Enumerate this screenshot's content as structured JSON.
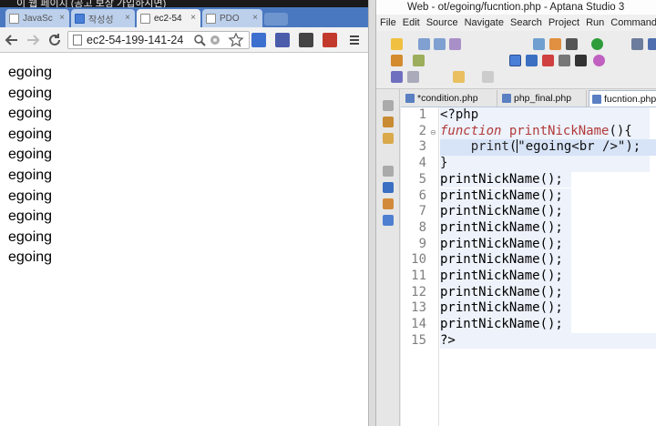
{
  "video_title": "이 웹 페이지 (공고 보상 가입하시면)",
  "browser": {
    "tabs": [
      {
        "label": "JavaSc",
        "active": false
      },
      {
        "label": "작성성",
        "active": false
      },
      {
        "label": "ec2-54",
        "active": true
      },
      {
        "label": "PDO",
        "active": false
      }
    ],
    "close_glyph": "×",
    "address": "ec2-54-199-141-24",
    "output_lines": [
      "egoing",
      "egoing",
      "egoing",
      "egoing",
      "egoing",
      "egoing",
      "egoing",
      "egoing",
      "egoing",
      "egoing"
    ]
  },
  "ide": {
    "window_title": "Web - ot/egoing/fucntion.php - Aptana Studio 3",
    "menu": [
      "File",
      "Edit",
      "Source",
      "Navigate",
      "Search",
      "Project",
      "Run",
      "Commands"
    ],
    "editor_tabs": [
      {
        "label": "*condition.php",
        "active": false
      },
      {
        "label": "php_final.php",
        "active": false
      },
      {
        "label": "fucntion.php",
        "active": true
      }
    ],
    "line_numbers": [
      "1",
      "2",
      "3",
      "4",
      "5",
      "6",
      "7",
      "8",
      "9",
      "10",
      "11",
      "12",
      "13",
      "14",
      "15"
    ],
    "code": {
      "l1": "<?php",
      "l2_kw": "function",
      "l2_fn": " printNickName",
      "l2_rest": "(){",
      "l3_indent": "    print",
      "l3_open": "(",
      "l3_str_a": "\"egoing<b",
      "l3_str_b": "r />\"",
      "l3_end": ");",
      "l4": "}",
      "calls": [
        "printNickName();",
        "printNickName();",
        "printNickName();",
        "printNickName();",
        "printNickName();",
        "printNickName();",
        "printNickName();",
        "printNickName();",
        "printNickName();",
        "printNickName();"
      ],
      "l15": "?>"
    }
  },
  "icons": [
    "page-icon",
    "back-arrow-icon",
    "forward-arrow-icon",
    "reload-icon",
    "zoom-icon",
    "star-icon",
    "menu-icon",
    "fold-minus-icon"
  ]
}
